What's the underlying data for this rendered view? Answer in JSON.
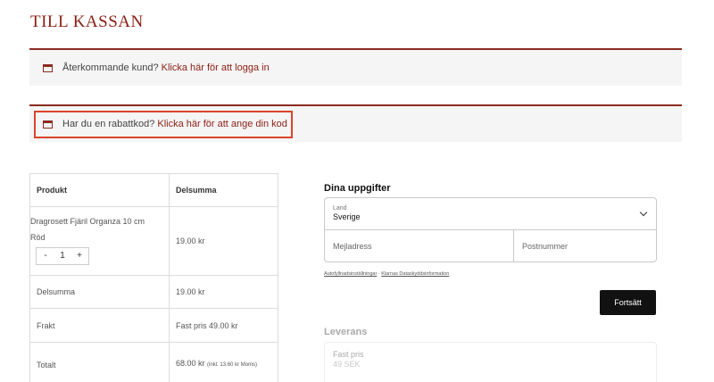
{
  "page": {
    "title": "TILL KASSAN"
  },
  "notices": {
    "returning": {
      "text": "Återkommande kund?",
      "link": "Klicka här för att logga in"
    },
    "coupon": {
      "text": "Har du en rabattkod?",
      "link": "Klicka här för att ange din kod"
    }
  },
  "order": {
    "headers": {
      "product": "Produkt",
      "subtotal": "Delsumma"
    },
    "item": {
      "name": "Dragrosett Fjäril Organza 10 cm",
      "variant": "Röd",
      "price": "19.00 kr",
      "qty": {
        "minus": "-",
        "value": "1",
        "plus": "+"
      }
    },
    "subtotal": {
      "label": "Delsumma",
      "value": "19.00 kr"
    },
    "shipping": {
      "label": "Frakt",
      "value": "Fast pris 49.00 kr"
    },
    "total": {
      "label": "Totalt",
      "value": "68.00 kr",
      "tax": "(inkl. 13.60 kr Moms)"
    }
  },
  "details": {
    "title": "Dina uppgifter",
    "country_label": "Land",
    "country_value": "Sverige",
    "email_placeholder": "Mejladress",
    "zip_placeholder": "Postnummer",
    "links": {
      "autofill": "Autofyllnadsinställningar",
      "separator": "·",
      "privacy": "Klarnas Dataskyddsinformation"
    },
    "continue_label": "Fortsätt"
  },
  "delivery": {
    "title": "Leverans",
    "option_name": "Fast pris",
    "option_price": "49 SEK"
  },
  "colors": {
    "accent": "#8b1d12",
    "highlight": "#d9452b",
    "button": "#111111"
  }
}
